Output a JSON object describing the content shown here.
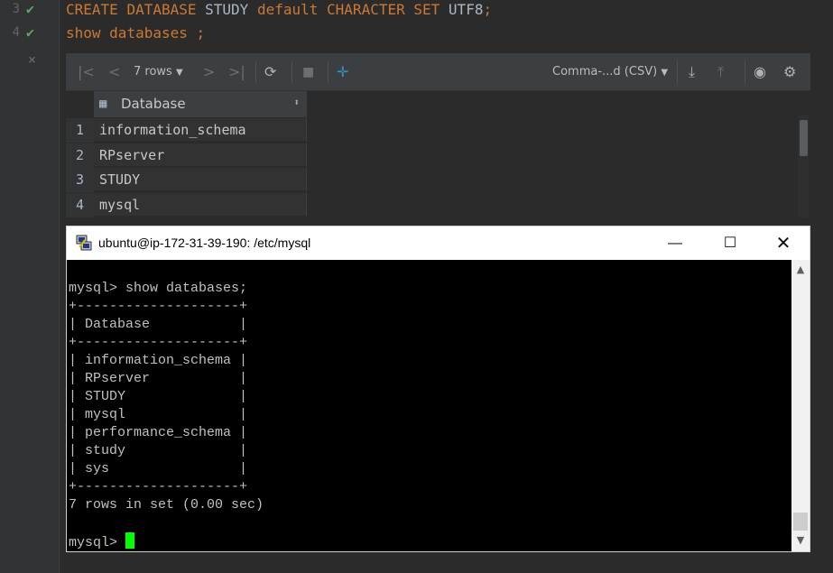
{
  "editor": {
    "line_numbers": [
      "3",
      "4"
    ],
    "line3": {
      "create": "CREATE",
      "database": "DATABASE",
      "name": "STUDY",
      "default": "default",
      "character": "CHARACTER",
      "set": "SET",
      "charset": "UTF8",
      "semicolon": ";"
    },
    "line4": {
      "show": "show",
      "databases": "databases",
      "semicolon": ";"
    }
  },
  "results": {
    "toolbar": {
      "rows_label": "7 rows",
      "format_label": "Comma-...d (CSV)"
    },
    "column_header": "Database",
    "rows": [
      {
        "num": "1",
        "value": "information_schema"
      },
      {
        "num": "2",
        "value": "RPserver"
      },
      {
        "num": "3",
        "value": "STUDY"
      },
      {
        "num": "4",
        "value": "mysql"
      }
    ]
  },
  "terminal": {
    "title": "ubuntu@ip-172-31-39-190: /etc/mysql",
    "lines": [
      "mysql> show databases;",
      "+--------------------+",
      "| Database           |",
      "+--------------------+",
      "| information_schema |",
      "| RPserver           |",
      "| STUDY              |",
      "| mysql              |",
      "| performance_schema |",
      "| study              |",
      "| sys                |",
      "+--------------------+",
      "7 rows in set (0.00 sec)",
      "",
      "mysql> "
    ]
  },
  "colors": {
    "keyword": "#cc7832",
    "identifier": "#a9b7c6",
    "check": "#59a869",
    "cursor": "#00ff00"
  }
}
